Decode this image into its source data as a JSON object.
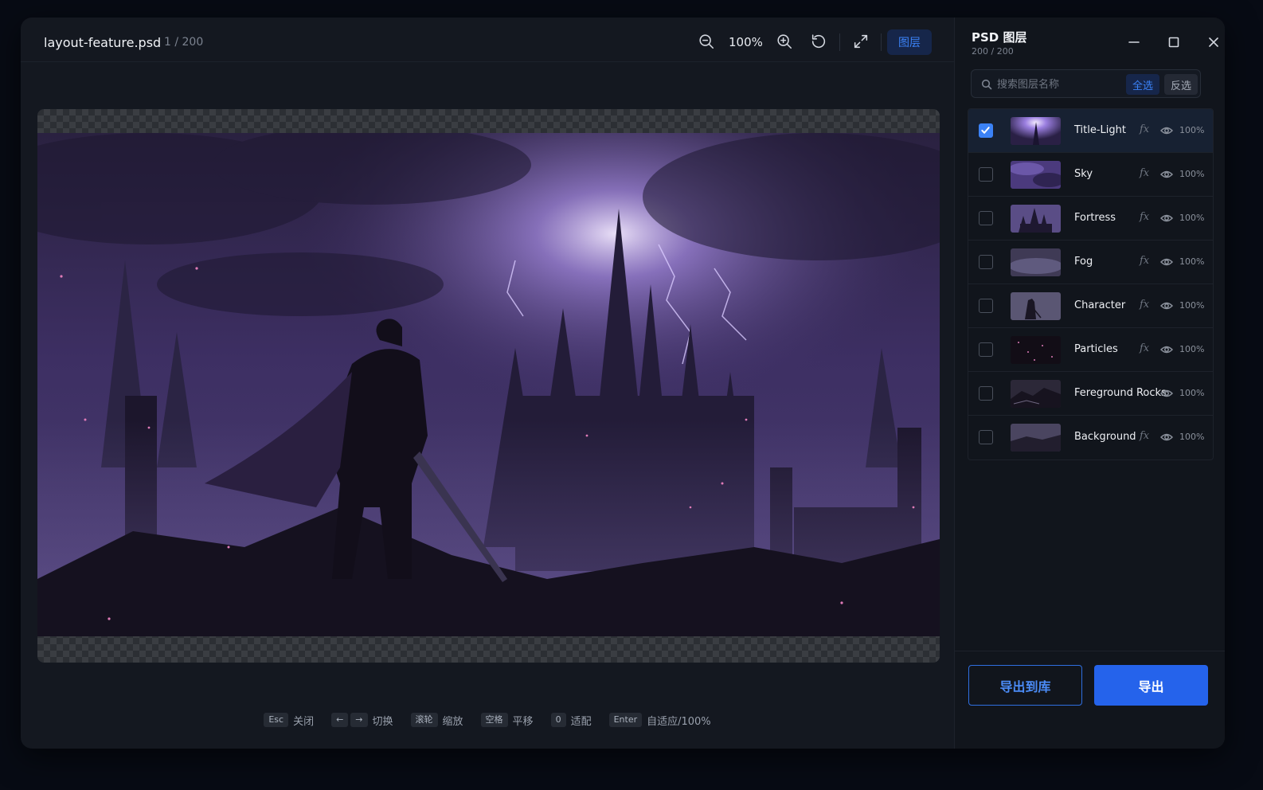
{
  "viewer": {
    "filename": "layout-feature.psd",
    "page_count": "1 / 200",
    "zoom_level": "100%",
    "layers_toggle": "图层"
  },
  "shortcuts": [
    {
      "keys": [
        "Esc"
      ],
      "label": "关闭"
    },
    {
      "keys": [
        "←",
        "→"
      ],
      "label": "切换"
    },
    {
      "keys": [
        "滚轮"
      ],
      "label": "缩放"
    },
    {
      "keys": [
        "空格"
      ],
      "label": "平移"
    },
    {
      "keys": [
        "0"
      ],
      "label": "适配"
    },
    {
      "keys": [
        "Enter"
      ],
      "label": "自适应/100%"
    }
  ],
  "panel": {
    "title": "PSD 图层",
    "count": "200 / 200",
    "search_placeholder": "搜索图层名称",
    "select_all": "全选",
    "invert": "反选",
    "export_to_library": "导出到库",
    "export": "导出"
  },
  "layers": [
    {
      "name": "Title-Light",
      "fx": "fx",
      "opacity": "100%",
      "checked": true,
      "thumb": "title-light"
    },
    {
      "name": "Sky",
      "fx": "fx",
      "opacity": "100%",
      "checked": false,
      "thumb": "sky"
    },
    {
      "name": "Fortress",
      "fx": "fx",
      "opacity": "100%",
      "checked": false,
      "thumb": "fortress"
    },
    {
      "name": "Fog",
      "fx": "fx",
      "opacity": "100%",
      "checked": false,
      "thumb": "fog"
    },
    {
      "name": "Character",
      "fx": "fx",
      "opacity": "100%",
      "checked": false,
      "thumb": "character"
    },
    {
      "name": "Particles",
      "fx": "fx",
      "opacity": "100%",
      "checked": false,
      "thumb": "particles"
    },
    {
      "name": "Fereground Rocks",
      "fx": "",
      "opacity": "100%",
      "checked": false,
      "thumb": "rocks"
    },
    {
      "name": "Background",
      "fx": "fx",
      "opacity": "100%",
      "checked": false,
      "thumb": "background"
    }
  ],
  "colors": {
    "accent": "#3b82f6",
    "window_bg": "#141820",
    "panel_bg": "#11151c",
    "artwork_purple": "#5b4a9a"
  },
  "icons": [
    "zoom-out-icon",
    "zoom-in-icon",
    "rotate-icon",
    "fullscreen-icon",
    "minimize-icon",
    "maximize-icon",
    "close-icon",
    "search-icon",
    "checkbox-check-icon",
    "eye-icon"
  ]
}
